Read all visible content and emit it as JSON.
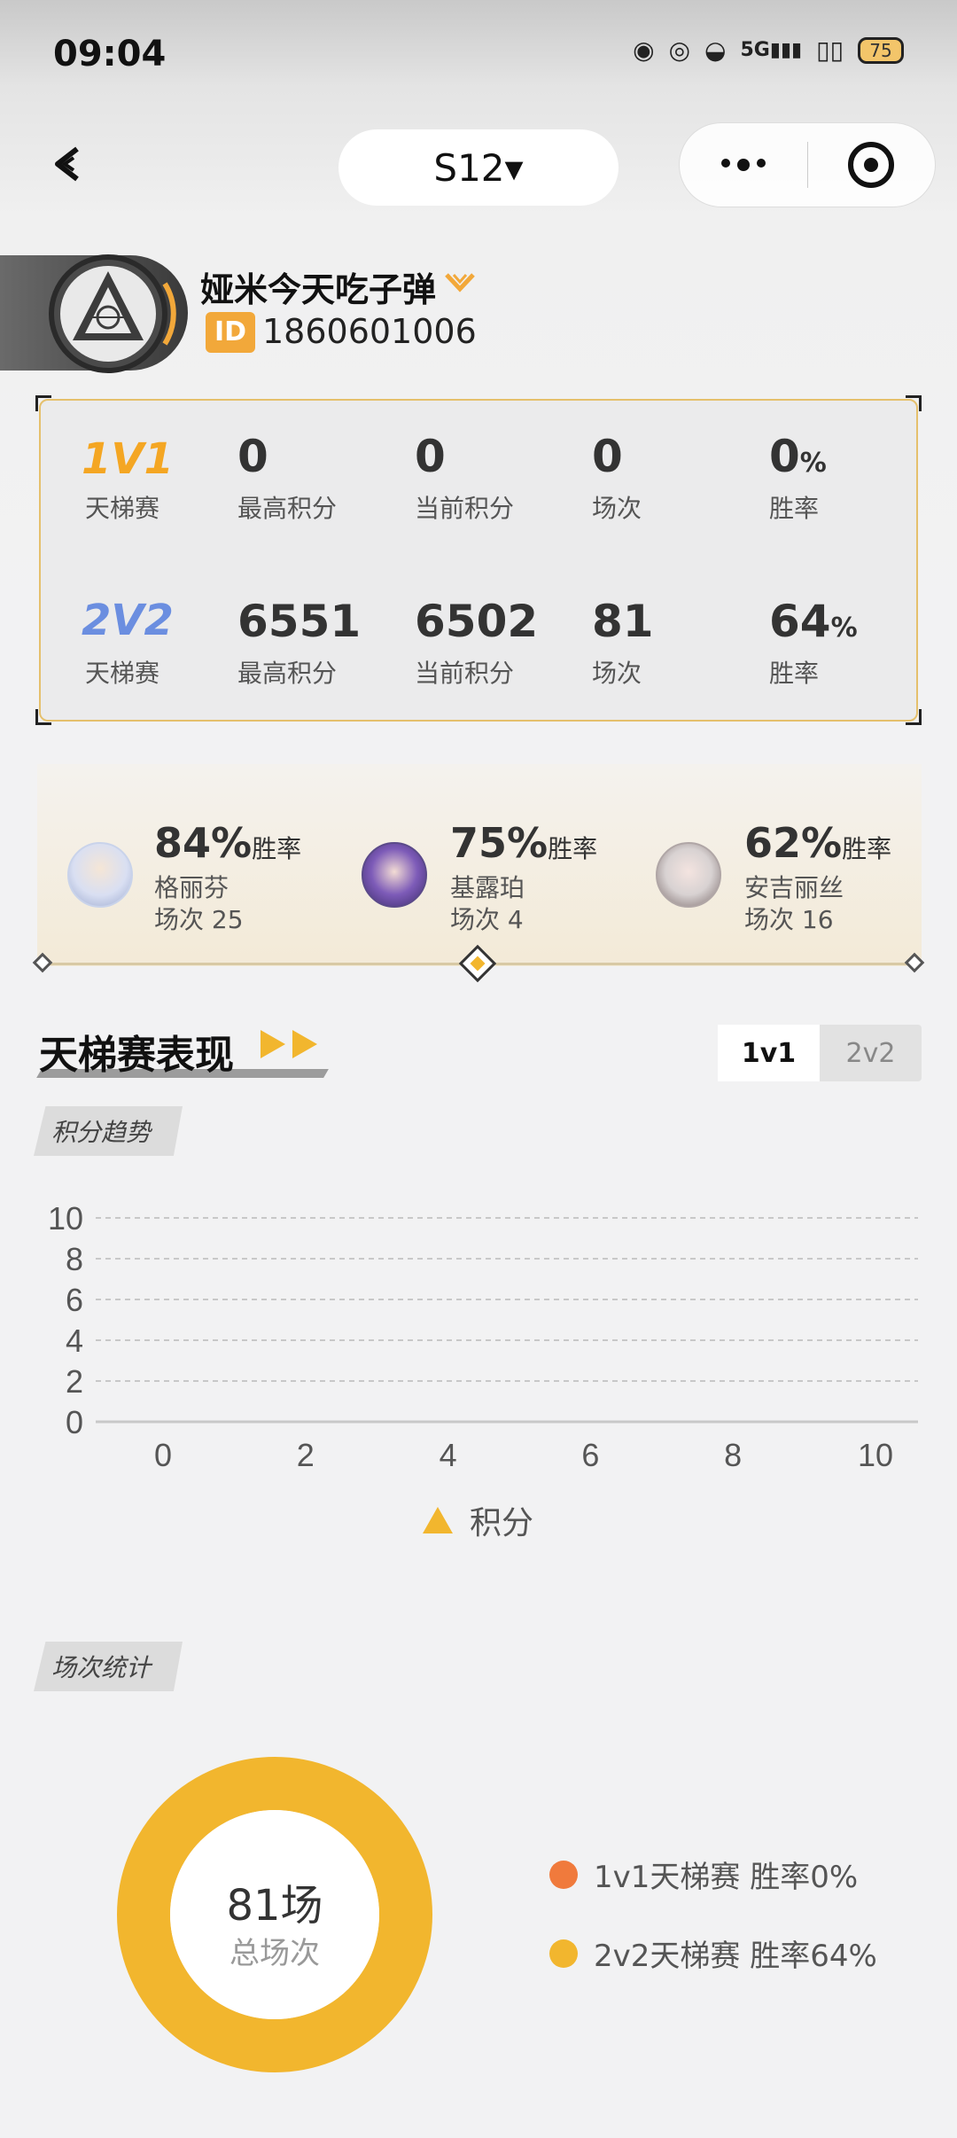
{
  "status_bar": {
    "time": "09:04",
    "battery": "75",
    "network": "5G"
  },
  "nav": {
    "season": "S12▾"
  },
  "profile": {
    "username": "娅米今天吃子弹",
    "id_badge": "ID",
    "uid": "1860601006"
  },
  "modes": [
    {
      "logo": "1V1",
      "sub": "天梯赛",
      "color": "#f4a623",
      "max_score": "0",
      "cur_score": "0",
      "matches": "0",
      "winrate": "0",
      "pct": "%"
    },
    {
      "logo": "2V2",
      "sub": "天梯赛",
      "color": "#6b8ee0",
      "max_score": "6551",
      "cur_score": "6502",
      "matches": "81",
      "winrate": "64",
      "pct": "%"
    }
  ],
  "stat_labels": {
    "max": "最高积分",
    "cur": "当前积分",
    "matches": "场次",
    "winrate": "胜率"
  },
  "heroes": [
    {
      "pct": "84%",
      "pct_label": "胜率",
      "name": "格丽芬",
      "count": "场次 25"
    },
    {
      "pct": "75%",
      "pct_label": "胜率",
      "name": "基露珀",
      "count": "场次 4"
    },
    {
      "pct": "62%",
      "pct_label": "胜率",
      "name": "安吉丽丝",
      "count": "场次 16"
    }
  ],
  "section": {
    "title": "天梯赛表现",
    "tabs": [
      "1v1",
      "2v2"
    ],
    "active_tab": "1v1"
  },
  "trend": {
    "tag": "积分趋势"
  },
  "match_stats": {
    "tag": "场次统计",
    "total": "81场",
    "total_label": "总场次"
  },
  "chart_data": [
    {
      "type": "line",
      "title": "积分趋势",
      "series": [
        {
          "name": "积分",
          "values": []
        }
      ],
      "x_ticks": [
        "0",
        "2",
        "4",
        "6",
        "8",
        "10"
      ],
      "y_ticks": [
        "0",
        "2",
        "4",
        "6",
        "8",
        "10"
      ],
      "xlim": [
        0,
        10
      ],
      "ylim": [
        0,
        10
      ],
      "grid": true,
      "legend": "bottom-center"
    },
    {
      "type": "pie",
      "title": "场次统计",
      "labels": [
        "1v1天梯赛 胜率0%",
        "2v2天梯赛 胜率64%"
      ],
      "values": [
        0,
        81
      ],
      "colors": [
        "#f07a3c",
        "#f2b62e"
      ],
      "legend": "right"
    }
  ]
}
